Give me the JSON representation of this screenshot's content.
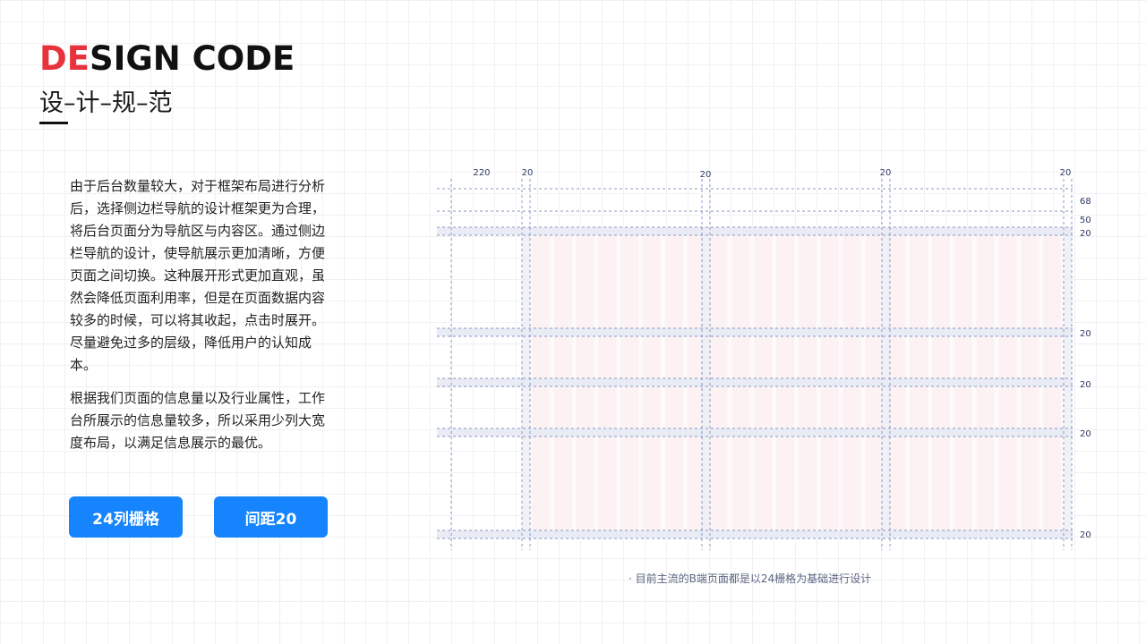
{
  "header": {
    "title_accent": "DE",
    "title_rest": "SIGN CODE",
    "subtitle": "设–计–规–范"
  },
  "content": {
    "paragraph_1": "由于后台数量较大，对于框架布局进行分析后，选择侧边栏导航的设计框架更为合理，将后台页面分为导航区与内容区。通过侧边栏导航的设计，使导航展示更加清晰，方便页面之间切换。这种展开形式更加直观，虽然会降低页面利用率，但是在页面数据内容较多的时候，可以将其收起，点击时展开。尽量避免过多的层级，降低用户的认知成本。",
    "paragraph_2": "根据我们页面的信息量以及行业属性，工作台所展示的信息量较多，所以采用少列大宽度布局，以满足信息展示的最优。"
  },
  "buttons": {
    "columns_label": "24列栅格",
    "spacing_label": "间距20"
  },
  "diagram": {
    "columns": 24,
    "top_labels": [
      "220",
      "20",
      "20",
      "20",
      "20"
    ],
    "right_labels": [
      "68",
      "50",
      "20",
      "20",
      "20",
      "20",
      "20"
    ],
    "caption": "· 目前主流的B端页面都是以24栅格为基础进行设计"
  },
  "colors": {
    "accent": "#e8323c",
    "button": "#1684fc",
    "guide": "#8a98c2",
    "column_tint": "#fcf1f3",
    "band_tint": "#e9ecf5"
  }
}
